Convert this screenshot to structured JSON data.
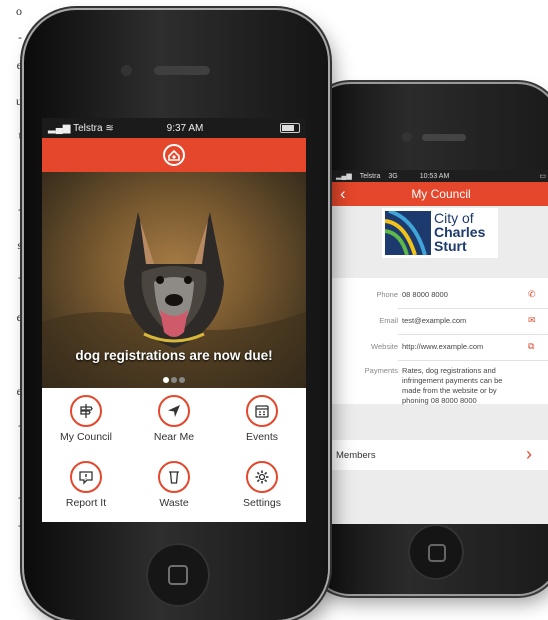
{
  "page_fragments": [
    "o",
    "-",
    "e",
    "u",
    "t",
    "-",
    "s",
    "-",
    "e",
    "e",
    "-",
    "-",
    "-"
  ],
  "phone_front": {
    "status": {
      "carrier": "Telstra",
      "time": "9:37 AM"
    },
    "hero_caption": "dog registrations are now due!",
    "menu": [
      {
        "label": "My Council",
        "icon": "signpost-icon"
      },
      {
        "label": "Near Me",
        "icon": "location-arrow-icon"
      },
      {
        "label": "Events",
        "icon": "calendar-icon"
      },
      {
        "label": "Report It",
        "icon": "report-icon"
      },
      {
        "label": "Waste",
        "icon": "bin-icon"
      },
      {
        "label": "Settings",
        "icon": "gear-icon"
      }
    ]
  },
  "phone_back": {
    "status": {
      "carrier": "Telstra",
      "network": "3G",
      "time": "10:53 AM"
    },
    "nav_title": "My Council",
    "logo": {
      "line1": "City of",
      "line2": "Charles",
      "line3": "Sturt"
    },
    "details": [
      {
        "key": "Phone",
        "value": "08 8000 8000"
      },
      {
        "key": "Email",
        "value": "test@example.com"
      },
      {
        "key": "Website",
        "value": "http://www.example.com"
      },
      {
        "key": "Payments",
        "value": "Rates, dog registrations and infringement payments can be made from the website or by phoning 08 8000 8000"
      }
    ],
    "members_label": "Members"
  },
  "colors": {
    "accent": "#e4472b",
    "logo_blue": "#1c3a6e"
  }
}
